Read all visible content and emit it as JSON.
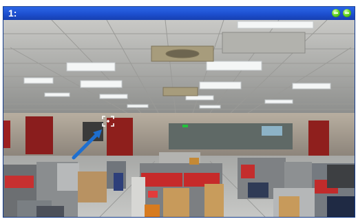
{
  "viewer": {
    "channel_label": "1:",
    "status_icons": [
      "status-ok-icon",
      "status-ok-icon"
    ],
    "status_color": "#5fd21f",
    "titlebar_color": "#1d4fcf"
  },
  "video": {
    "scene": "office-interior",
    "target_overlay_icon": "crosshair-focus-icon",
    "pointer_icon": "arrow-pointer-icon",
    "pointer_color": "#1e6fd0"
  }
}
